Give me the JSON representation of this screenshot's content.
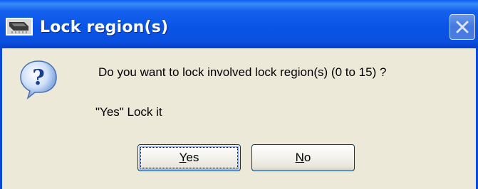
{
  "window": {
    "title": "Lock region(s)"
  },
  "message": {
    "text": "Do you want to lock involved lock region(s) (0 to 15) ?",
    "detail": "\"Yes\" Lock it"
  },
  "buttons": {
    "yes": {
      "mnemonic": "Y",
      "rest": "es"
    },
    "no": {
      "mnemonic": "N",
      "rest": "o"
    }
  },
  "icons": {
    "app": "chip-icon",
    "message": "question-icon",
    "close": "close-icon"
  },
  "colors": {
    "titlebar": "#0a54e6",
    "client_background": "#ece9d8",
    "button_border": "#003c74"
  }
}
